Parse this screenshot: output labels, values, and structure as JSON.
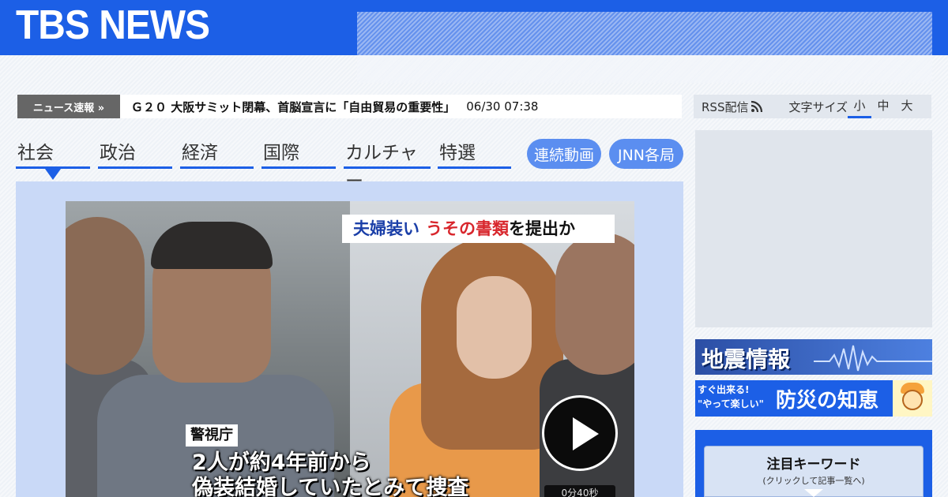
{
  "header": {
    "logo": "TBS NEWS"
  },
  "ticker": {
    "label": "ニュース速報 »",
    "headline": "Ｇ２０ 大阪サミット閉幕、首脳宣言に「自由貿易の重要性」",
    "time": "06/30 07:38"
  },
  "nav": {
    "tabs": [
      {
        "label": "社会"
      },
      {
        "label": "政治"
      },
      {
        "label": "経済"
      },
      {
        "label": "国際"
      },
      {
        "label": "カルチャー"
      },
      {
        "label": "特選"
      }
    ],
    "pills": [
      {
        "label": "連続動画"
      },
      {
        "label": "JNN各局"
      }
    ]
  },
  "video": {
    "caption_top": {
      "part1": "夫婦装い",
      "part2": "うその書類",
      "part3": "を提出か"
    },
    "tag": "警視庁",
    "caption_line1": "2人が約4年前から",
    "caption_line2": "偽装結婚していたとみて捜査",
    "duration": "0分40秒"
  },
  "utility": {
    "rss_label": "RSS配信",
    "fontsize_label": "文字サイズ",
    "fontsize_options": [
      "小",
      "中",
      "大"
    ]
  },
  "banners": {
    "quake": "地震情報",
    "bousai_line1": "すぐ出来る!",
    "bousai_line2": "\"やって楽しい\"",
    "bousai_main": "防災の知恵"
  },
  "keywords": {
    "title": "注目キーワード",
    "subtitle": "(クリックして記事一覧へ)"
  },
  "colors": {
    "brand_blue": "#1c5fe6",
    "pill_blue": "#5b8ef0",
    "ticker_label_bg": "#666666"
  }
}
